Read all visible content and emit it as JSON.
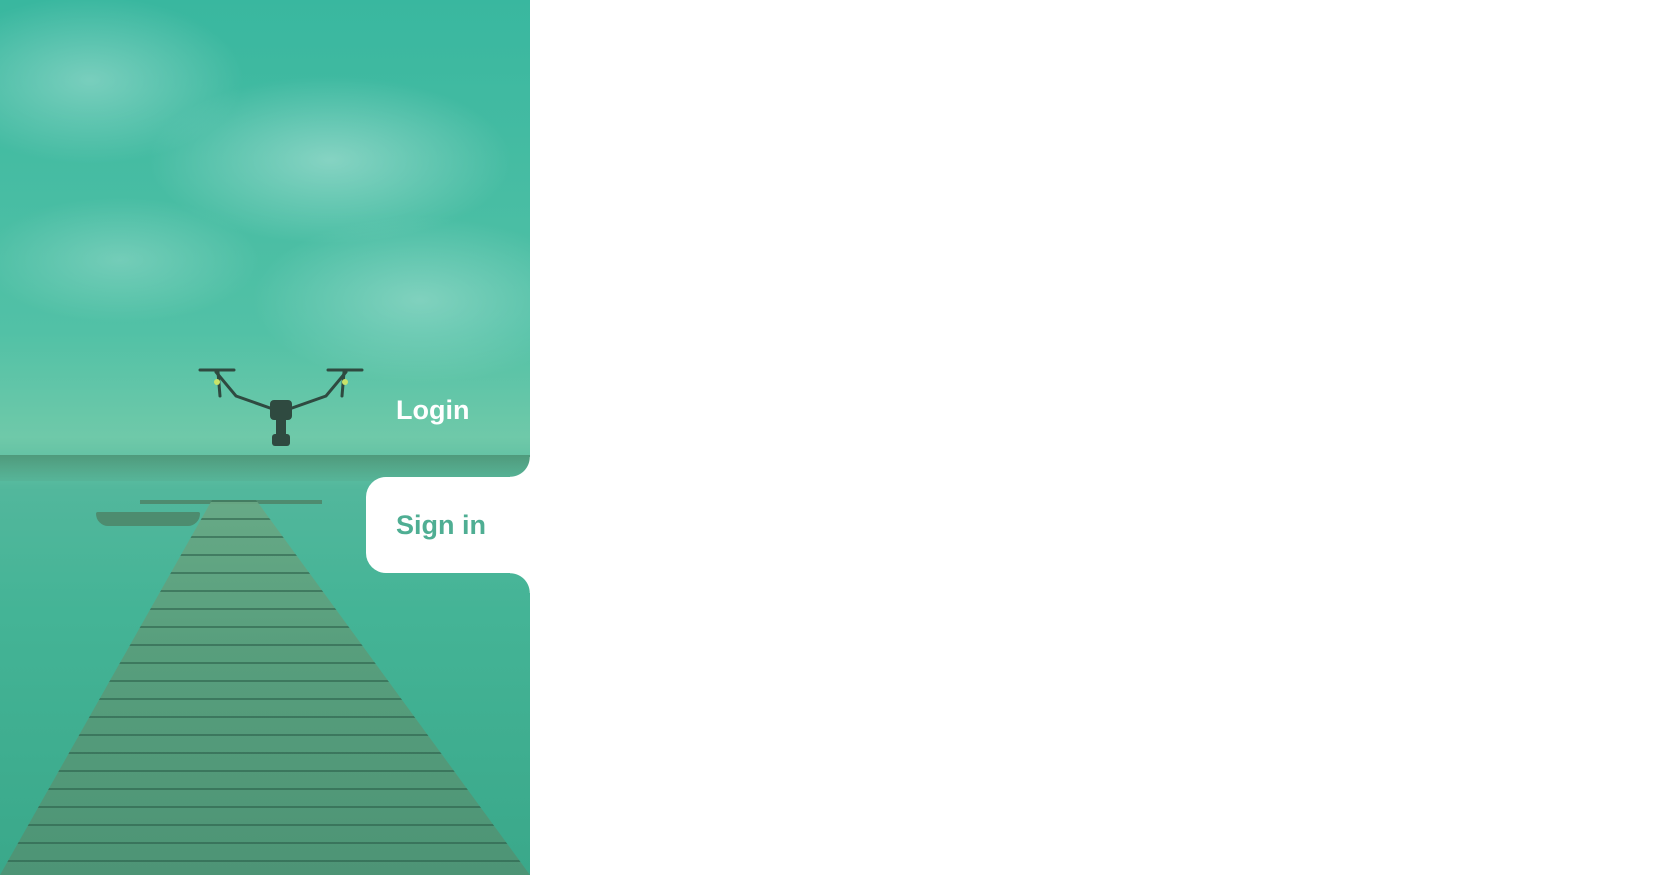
{
  "side_panel": {
    "image": "lake-pier-with-drone-photo",
    "overlay_color": "#3fb69c"
  },
  "tabs": [
    {
      "label": "Login",
      "active": false
    },
    {
      "label": "Sign in",
      "active": true
    }
  ],
  "colors": {
    "accent": "#4fae93",
    "background": "#ffffff",
    "inactive_tab_text": "#ffffff"
  }
}
